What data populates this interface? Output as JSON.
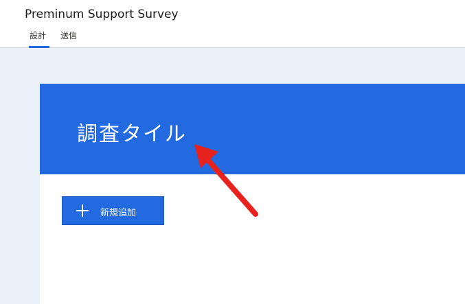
{
  "app": {
    "title": "Preminum Support Survey"
  },
  "tabs": [
    {
      "label": "設計",
      "active": true
    },
    {
      "label": "送信",
      "active": false
    }
  ],
  "form": {
    "title": "調査タイル",
    "add_button_label": "新規追加"
  },
  "colors": {
    "accent": "#2369e0",
    "canvas_bg": "#ebf1fb",
    "annotation": "#e8231f"
  },
  "icons": {
    "add": "plus-icon",
    "annotation": "red-arrow-icon"
  }
}
